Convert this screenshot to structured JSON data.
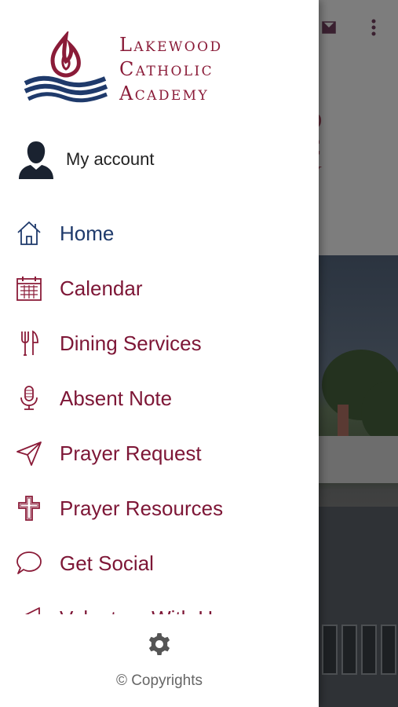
{
  "brand": {
    "line1": "Lakewood",
    "line2": "Catholic",
    "line3": "Academy",
    "logo_icon": "flame-over-waves-icon"
  },
  "account": {
    "label": "My account",
    "icon": "person-silhouette-icon"
  },
  "menu": {
    "items": [
      {
        "label": "Home",
        "icon": "house-icon",
        "active": true
      },
      {
        "label": "Calendar",
        "icon": "calendar-icon"
      },
      {
        "label": "Dining Services",
        "icon": "fork-knife-icon"
      },
      {
        "label": "Absent Note",
        "icon": "microphone-icon"
      },
      {
        "label": "Prayer Request",
        "icon": "paper-plane-icon"
      },
      {
        "label": "Prayer Resources",
        "icon": "cross-icon"
      },
      {
        "label": "Get Social",
        "icon": "speech-bubble-icon"
      },
      {
        "label": "Volunteer With Us",
        "icon": "megaphone-icon"
      }
    ]
  },
  "footer": {
    "settings_icon": "gear-icon",
    "copyright": "© Copyrights"
  },
  "background": {
    "ghost_logo_lines": [
      "D",
      "C",
      "Y"
    ],
    "icons": [
      "mail-icon",
      "more-vertical-icon"
    ]
  },
  "colors": {
    "brand_red": "#8a1b38",
    "menu_text": "#7d1636",
    "active_text": "#1f3a6b",
    "navy": "#1f3a6b"
  }
}
